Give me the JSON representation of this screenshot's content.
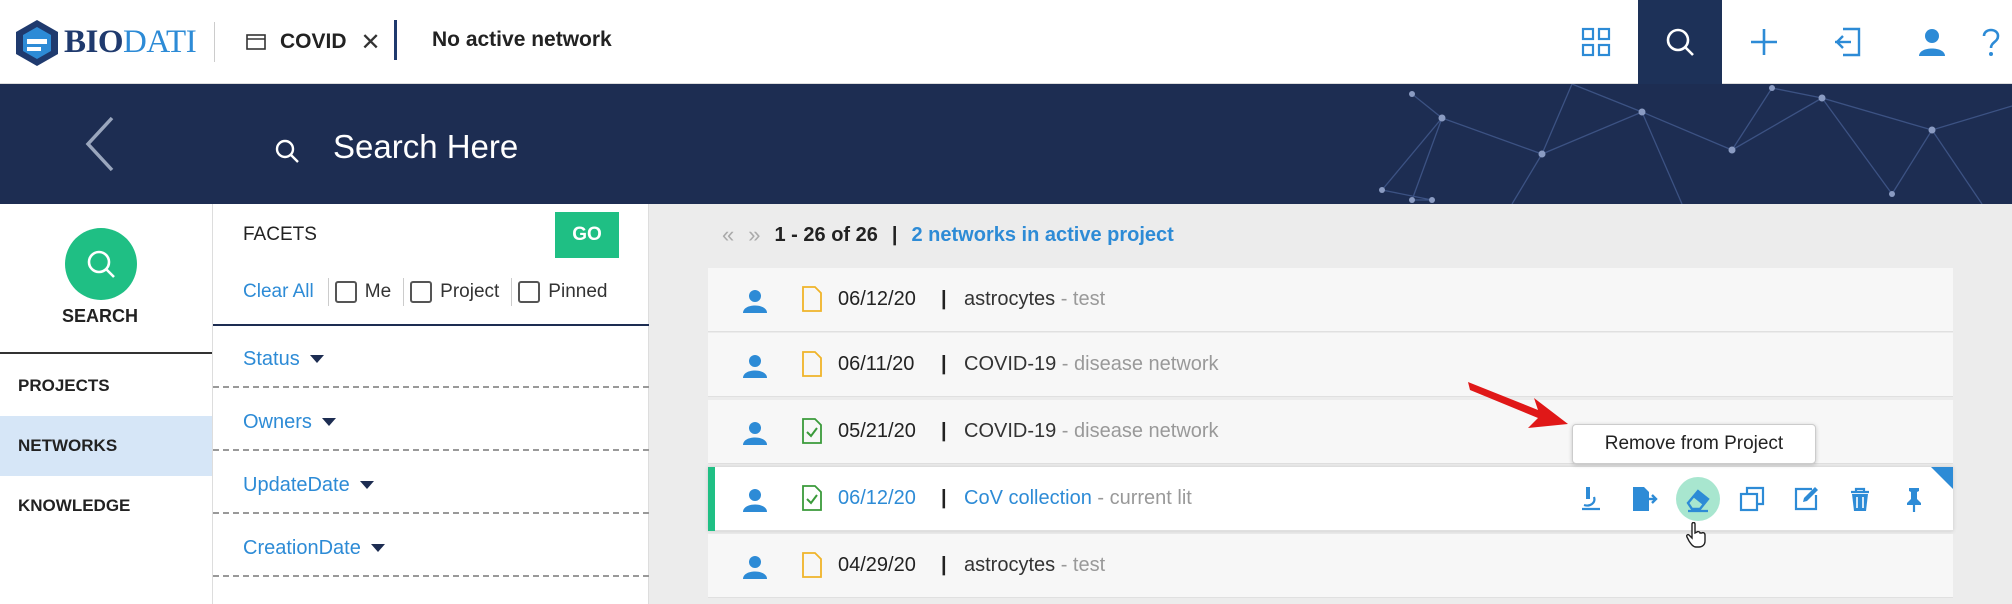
{
  "brand": {
    "part1": "BIO",
    "part2": "DATI"
  },
  "project_tab": {
    "name": "COVID",
    "close": "✕"
  },
  "network_status": "No active network",
  "top_actions": [
    "apps-grid-icon",
    "search-icon",
    "add-icon",
    "login-icon",
    "user-icon",
    "help-icon"
  ],
  "search": {
    "placeholder": "Search Here"
  },
  "leftnav": {
    "search_label": "SEARCH",
    "items": [
      "PROJECTS",
      "NETWORKS",
      "KNOWLEDGE"
    ],
    "selected": "NETWORKS"
  },
  "facets": {
    "heading": "FACETS",
    "go_label": "GO",
    "clear_all": "Clear All",
    "checkboxes": [
      "Me",
      "Project",
      "Pinned"
    ],
    "groups": [
      "Status",
      "Owners",
      "UpdateDate",
      "CreationDate"
    ]
  },
  "results": {
    "first": "«",
    "last": "»",
    "range": "1 - 26 of 26",
    "separator": "|",
    "networks_in_project": "2 networks in active project",
    "rows": [
      {
        "date": "06/12/20",
        "name": "astrocytes",
        "desc": " - test",
        "doc": "plain"
      },
      {
        "date": "06/11/20",
        "name": "COVID-19",
        "desc": " - disease network",
        "doc": "plain"
      },
      {
        "date": "05/21/20",
        "name": "COVID-19",
        "desc": " - disease network",
        "doc": "checked"
      },
      {
        "date": "06/12/20",
        "name": "CoV collection",
        "desc": " - current lit",
        "doc": "checked",
        "active": true
      },
      {
        "date": "04/29/20",
        "name": "astrocytes",
        "desc": " - test",
        "doc": "plain"
      }
    ],
    "row_actions": [
      "microscope-icon",
      "export-icon",
      "eraser-icon",
      "copy-icon",
      "edit-icon",
      "trash-icon",
      "pin-icon"
    ],
    "tooltip": "Remove from Project"
  },
  "colors": {
    "navy": "#1d2d52",
    "green": "#1fbf84",
    "blue": "#2d8bd6"
  }
}
